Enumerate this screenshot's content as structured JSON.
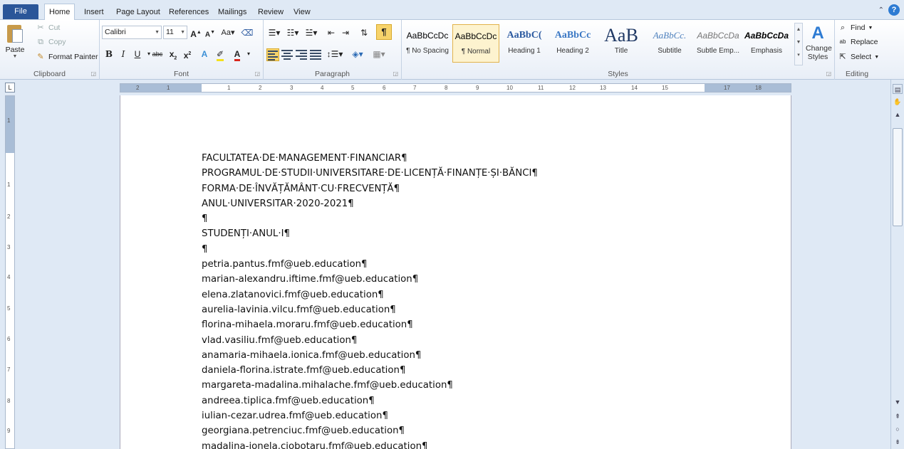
{
  "tabs": {
    "file": "File",
    "items": [
      "Home",
      "Insert",
      "Page Layout",
      "References",
      "Mailings",
      "Review",
      "View"
    ],
    "active": "Home"
  },
  "clipboard": {
    "paste": "Paste",
    "cut": "Cut",
    "copy": "Copy",
    "format_painter": "Format Painter",
    "label": "Clipboard"
  },
  "font": {
    "name": "Calibri",
    "size": "11",
    "label": "Font"
  },
  "paragraph": {
    "label": "Paragraph"
  },
  "styles": {
    "items": [
      {
        "sample": "AaBbCcDc",
        "name": "¶ No Spacing"
      },
      {
        "sample": "AaBbCcDc",
        "name": "¶ Normal"
      },
      {
        "sample": "AaBbC(",
        "name": "Heading 1"
      },
      {
        "sample": "AaBbCc",
        "name": "Heading 2"
      },
      {
        "sample": "AaB",
        "name": "Title"
      },
      {
        "sample": "AaBbCc.",
        "name": "Subtitle"
      },
      {
        "sample": "AaBbCcDa",
        "name": "Subtle Emp..."
      },
      {
        "sample": "AaBbCcDa",
        "name": "Emphasis"
      }
    ],
    "selected": 1,
    "change_styles": "Change Styles",
    "label": "Styles"
  },
  "editing": {
    "find": "Find",
    "replace": "Replace",
    "select": "Select",
    "label": "Editing"
  },
  "ruler": {
    "labels": [
      "2",
      "1",
      "1",
      "2",
      "3",
      "4",
      "5",
      "6",
      "7",
      "8",
      "9",
      "10",
      "11",
      "12",
      "13",
      "14",
      "15",
      "17",
      "18"
    ],
    "vlabels": [
      "1",
      "1",
      "2",
      "3",
      "4",
      "5",
      "6",
      "7",
      "8",
      "9"
    ]
  },
  "document": {
    "lines": [
      "FACULTATEA·DE·MANAGEMENT·FINANCIAR¶",
      "PROGRAMUL·DE·STUDII·UNIVERSITARE·DE·LICENȚĂ·FINANȚE·ȘI·BĂNCI¶",
      "FORMA·DE·ÎNVĂȚĂMÂNT·CU·FRECVENȚĂ¶",
      "ANUL·UNIVERSITAR·2020-2021¶",
      "¶",
      "STUDENȚI·ANUL·I¶",
      "¶",
      "petria.pantus.fmf@ueb.education¶",
      "marian-alexandru.iftime.fmf@ueb.education¶",
      "elena.zlatanovici.fmf@ueb.education¶",
      "aurelia-lavinia.vilcu.fmf@ueb.education¶",
      "florina-mihaela.moraru.fmf@ueb.education¶",
      "vlad.vasiliu.fmf@ueb.education¶",
      "anamaria-mihaela.ionica.fmf@ueb.education¶",
      "daniela-florina.istrate.fmf@ueb.education¶",
      "margareta-madalina.mihalache.fmf@ueb.education¶",
      "andreea.tiplica.fmf@ueb.education¶",
      "iulian-cezar.udrea.fmf@ueb.education¶",
      "georgiana.petrenciuc.fmf@ueb.education¶",
      "madalina-ionela.ciobotaru.fmf@ueb.education¶"
    ]
  }
}
